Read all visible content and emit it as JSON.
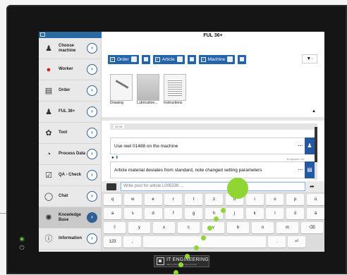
{
  "screen": {
    "title": "FUL 36+"
  },
  "sidebar": {
    "items": [
      {
        "label": "Choose machine",
        "icon": "machine-icon"
      },
      {
        "label": "Worker",
        "icon": "worker-icon"
      },
      {
        "label": "Order",
        "icon": "order-icon"
      },
      {
        "label": "FUL 36+",
        "icon": "machine-icon"
      },
      {
        "label": "Tool",
        "icon": "gear-icon"
      },
      {
        "label": "Process Data",
        "icon": "gauge-icon"
      },
      {
        "label": "QA - Check",
        "icon": "checklist-icon"
      },
      {
        "label": "Chat",
        "icon": "chat-icon"
      },
      {
        "label": "Knowledge Base",
        "icon": "bulb-icon",
        "active": true
      },
      {
        "label": "Information",
        "icon": "info-icon"
      }
    ]
  },
  "filters": {
    "chips": [
      {
        "label": "Order"
      },
      {
        "label": "Article"
      },
      {
        "label": "Machine"
      }
    ]
  },
  "documents": [
    {
      "label": "Drawing"
    },
    {
      "label": "Lubrication..."
    },
    {
      "label": "Instructions"
    }
  ],
  "posts": {
    "header_tag": "19.08.",
    "items": [
      {
        "text": "Use reel 01488 on the machine",
        "meta": ""
      },
      {
        "text": "Article material deviates from standard, note changed setting parameters",
        "meta": "Employee 011"
      }
    ]
  },
  "composer": {
    "placeholder": "Write post for article L005239 ..."
  },
  "keyboard": {
    "row1": [
      "q",
      "w",
      "e",
      "r",
      "t",
      "z",
      "u",
      "i",
      "o",
      "p",
      "ü"
    ],
    "row2": [
      "a",
      "s",
      "d",
      "f",
      "g",
      "h",
      "j",
      "k",
      "l",
      "ö",
      "ä"
    ],
    "row3": [
      "⇧",
      "y",
      "x",
      "c",
      "v",
      "b",
      "n",
      "m",
      "⌫"
    ],
    "row4": [
      "123",
      ",",
      ".",
      "⏎"
    ]
  },
  "brand": {
    "name": "IT ENGINEERING",
    "sub": "MES & PROCESS SOLUTIONS"
  }
}
